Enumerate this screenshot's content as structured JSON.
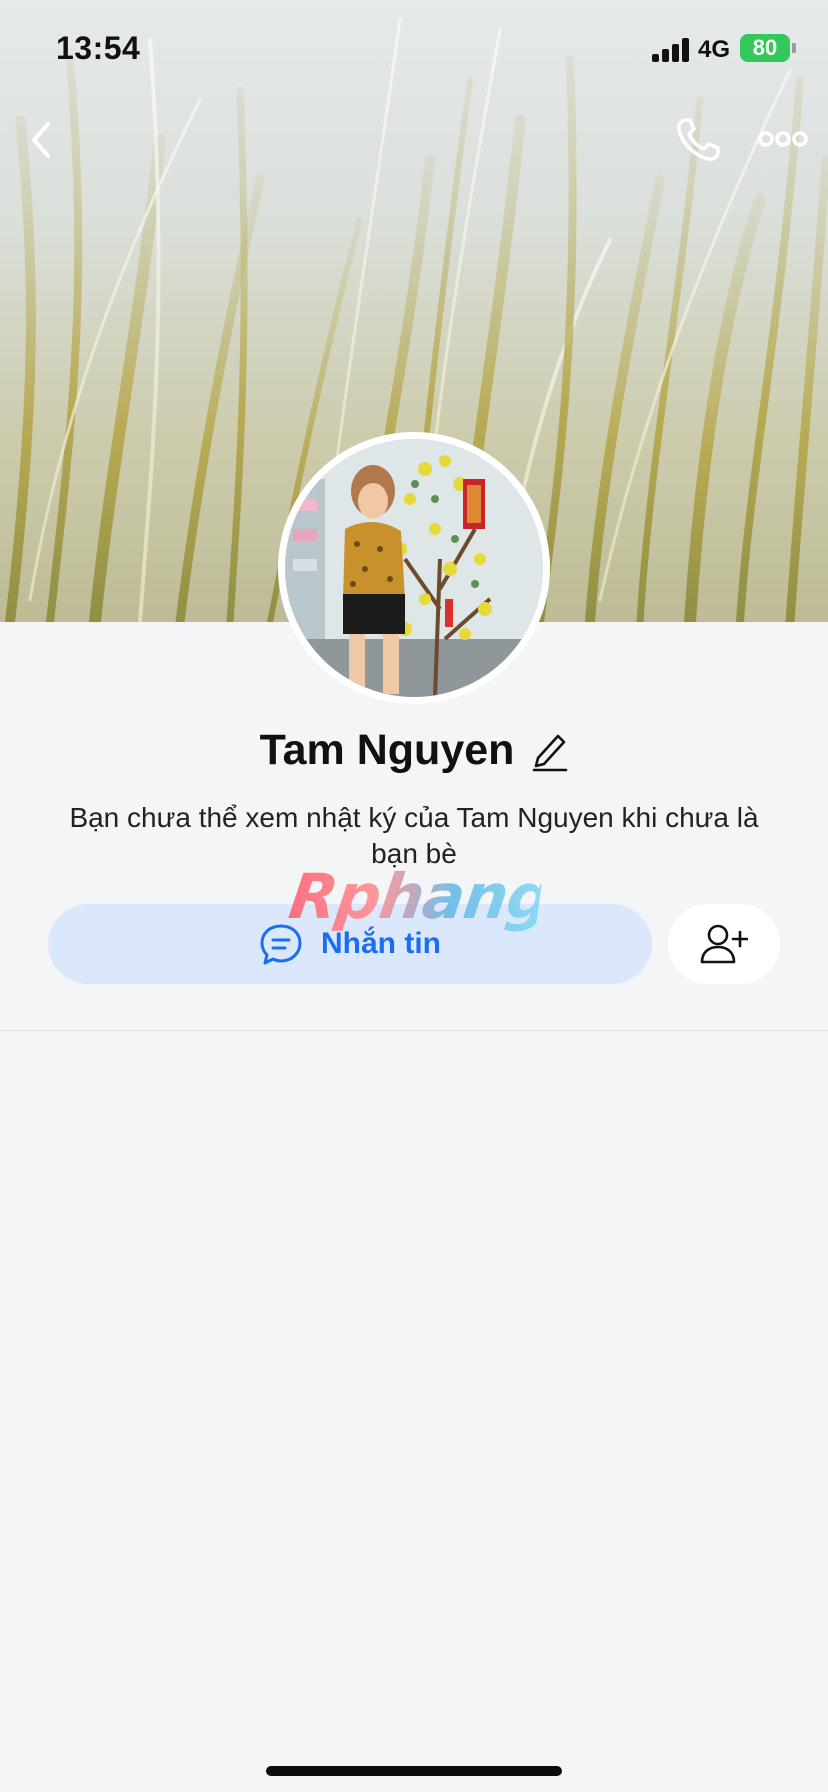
{
  "status_bar": {
    "time": "13:54",
    "network": "4G",
    "battery": "80"
  },
  "nav": {
    "back_icon": "chevron-left-icon",
    "call_icon": "phone-icon",
    "more_icon": "more-dots-icon"
  },
  "profile": {
    "name": "Tam Nguyen",
    "edit_icon": "pencil-icon",
    "notice": "Bạn chưa thể xem nhật ký của Tam Nguyen khi chưa là bạn bè"
  },
  "watermark": "Rphang",
  "actions": {
    "message_label": "Nhắn tin",
    "message_icon": "chat-bubble-icon",
    "add_friend_icon": "add-user-icon"
  },
  "colors": {
    "accent": "#1a6ef0",
    "message_button_bg": "#dbe8fb",
    "battery": "#34c759",
    "background": "#f4f5f7"
  }
}
